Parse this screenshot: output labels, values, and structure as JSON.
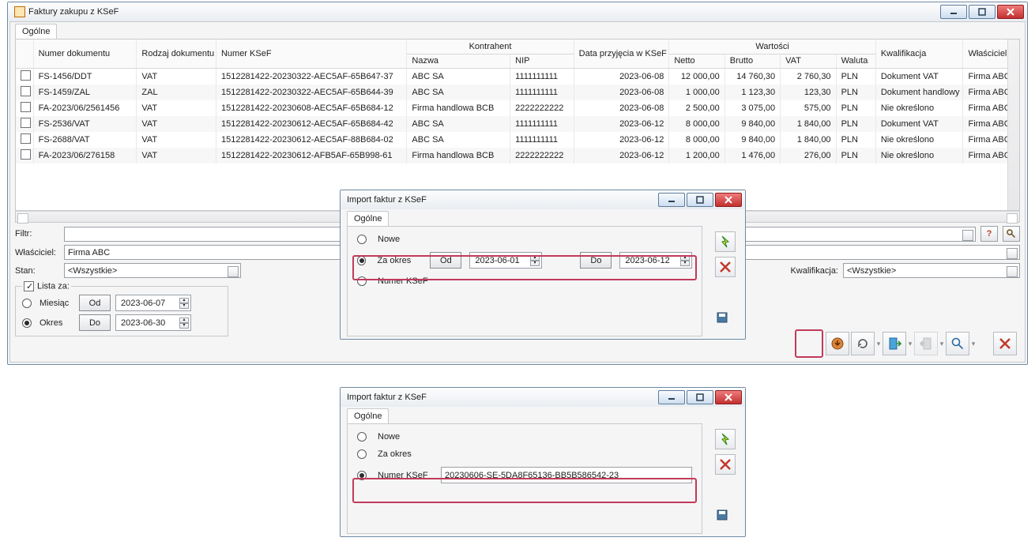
{
  "main_window": {
    "title": "Faktury zakupu z KSeF",
    "tab": "Ogólne",
    "columns": {
      "numer_dok": "Numer dokumentu",
      "rodzaj_dok": "Rodzaj dokumentu",
      "numer_ksef": "Numer KSeF",
      "kontrahent": "Kontrahent",
      "nazwa": "Nazwa",
      "nip": "NIP",
      "data_przyjecia": "Data przyjęcia w KSeF",
      "wartosci": "Wartości",
      "netto": "Netto",
      "brutto": "Brutto",
      "vat": "VAT",
      "waluta": "Waluta",
      "kwalifikacja": "Kwalifikacja",
      "wlasciciel": "Właściciel"
    },
    "rows": [
      {
        "numer_dok": "FS-1456/DDT",
        "rodzaj_dok": "VAT",
        "numer_ksef": "1512281422-20230322-AEC5AF-65B647-37",
        "nazwa": "ABC SA",
        "nip": "1111111111",
        "data": "2023-06-08",
        "netto": "12 000,00",
        "brutto": "14 760,30",
        "vat": "2 760,30",
        "waluta": "PLN",
        "kwal": "Dokument VAT",
        "wl": "Firma ABC"
      },
      {
        "numer_dok": "FS-1459/ZAL",
        "rodzaj_dok": "ZAL",
        "numer_ksef": "1512281422-20230322-AEC5AF-65B644-39",
        "nazwa": "ABC SA",
        "nip": "1111111111",
        "data": "2023-06-08",
        "netto": "1 000,00",
        "brutto": "1 123,30",
        "vat": "123,30",
        "waluta": "PLN",
        "kwal": "Dokument handlowy",
        "wl": "Firma ABC"
      },
      {
        "numer_dok": "FA-2023/06/2561456",
        "rodzaj_dok": "VAT",
        "numer_ksef": "1512281422-20230608-AEC5AF-65B684-12",
        "nazwa": "Firma handlowa BCB",
        "nip": "2222222222",
        "data": "2023-06-08",
        "netto": "2 500,00",
        "brutto": "3 075,00",
        "vat": "575,00",
        "waluta": "PLN",
        "kwal": "Nie określono",
        "wl": "Firma ABC"
      },
      {
        "numer_dok": "FS-2536/VAT",
        "rodzaj_dok": "VAT",
        "numer_ksef": "1512281422-20230612-AEC5AF-65B684-42",
        "nazwa": "ABC SA",
        "nip": "1111111111",
        "data": "2023-06-12",
        "netto": "8 000,00",
        "brutto": "9 840,00",
        "vat": "1 840,00",
        "waluta": "PLN",
        "kwal": "Dokument VAT",
        "wl": "Firma ABC"
      },
      {
        "numer_dok": "FS-2688/VAT",
        "rodzaj_dok": "VAT",
        "numer_ksef": "1512281422-20230612-AEC5AF-88B684-02",
        "nazwa": "ABC SA",
        "nip": "1111111111",
        "data": "2023-06-12",
        "netto": "8 000,00",
        "brutto": "9 840,00",
        "vat": "1 840,00",
        "waluta": "PLN",
        "kwal": "Nie określono",
        "wl": "Firma ABC"
      },
      {
        "numer_dok": "FA-2023/06/276158",
        "rodzaj_dok": "VAT",
        "numer_ksef": "1512281422-20230612-AFB5AF-65B998-61",
        "nazwa": "Firma handlowa BCB",
        "nip": "2222222222",
        "data": "2023-06-12",
        "netto": "1 200,00",
        "brutto": "1 476,00",
        "vat": "276,00",
        "waluta": "PLN",
        "kwal": "Nie określono",
        "wl": "Firma ABC"
      }
    ],
    "filter_label": "Filtr:",
    "owner_label": "Właściciel:",
    "owner_value": "Firma ABC",
    "stan_label": "Stan:",
    "stan_value": "<Wszystkie>",
    "kwalifikacja_label": "Kwalifikacja:",
    "kwalifikacja_value": "<Wszystkie>",
    "lista_za": "Lista za:",
    "miesiac": "Miesiąc",
    "okres": "Okres",
    "od": "Od",
    "do": "Do",
    "date_od": "2023-06-07",
    "date_do": "2023-06-30"
  },
  "dialog1": {
    "title": "Import faktur z KSeF",
    "tab": "Ogólne",
    "opt_nowe": "Nowe",
    "opt_za_okres": "Za okres",
    "opt_numer_ksef": "Numer KSeF",
    "btn_od": "Od",
    "btn_do": "Do",
    "date_od": "2023-06-01",
    "date_do": "2023-06-12"
  },
  "dialog2": {
    "title": "Import faktur z KSeF",
    "tab": "Ogólne",
    "opt_nowe": "Nowe",
    "opt_za_okres": "Za okres",
    "opt_numer_ksef": "Numer KSeF",
    "ksef_value": "20230606-SE-5DA8F65136-BB5B586542-23"
  }
}
